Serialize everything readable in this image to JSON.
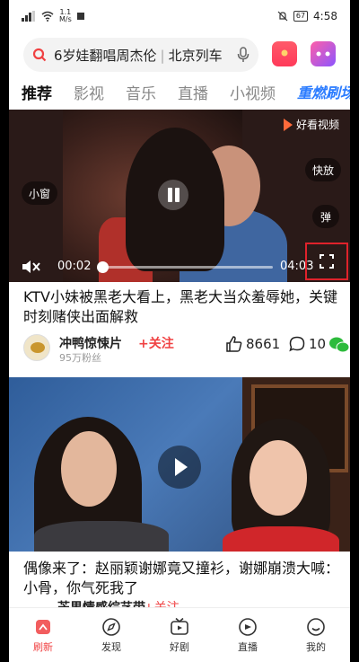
{
  "status_bar": {
    "net_speed": "1.1",
    "net_unit": "M/s",
    "battery": "67",
    "time": "4:58"
  },
  "search": {
    "query_primary": "6岁娃翻唱周杰伦",
    "query_secondary": "北京列车"
  },
  "tabs": [
    {
      "label": "推荐"
    },
    {
      "label": "影视"
    },
    {
      "label": "音乐"
    },
    {
      "label": "直播"
    },
    {
      "label": "小视频"
    },
    {
      "label": "重燃刷场"
    }
  ],
  "video1": {
    "source_label": "好看视频",
    "small_window": "小窗",
    "speed": "快放",
    "danmu": "弹",
    "current_time": "00:02",
    "total_time": "04:03",
    "progress": 0.01
  },
  "post1": {
    "title": "KTV小妹被黑老大看上，黑老大当众羞辱她，关键时刻赌侠出面解救",
    "author": "冲鸭惊悚片",
    "follow_label": "+关注",
    "fans": "95万粉丝",
    "likes": "8661",
    "comments": "10"
  },
  "post2": {
    "title": "偶像来了：赵丽颖谢娜竟又撞衫，谢娜崩溃大喊：小骨，你气死我了",
    "author": "芒果情感综艺带",
    "follow_label": "+关注"
  },
  "bottom_nav": [
    {
      "label": "刷新"
    },
    {
      "label": "发现"
    },
    {
      "label": "好剧"
    },
    {
      "label": "直播"
    },
    {
      "label": "我的"
    }
  ],
  "colors": {
    "accent_red": "#f04142",
    "highlight_box": "#e0222b",
    "wechat_green": "#2dbb3c"
  }
}
